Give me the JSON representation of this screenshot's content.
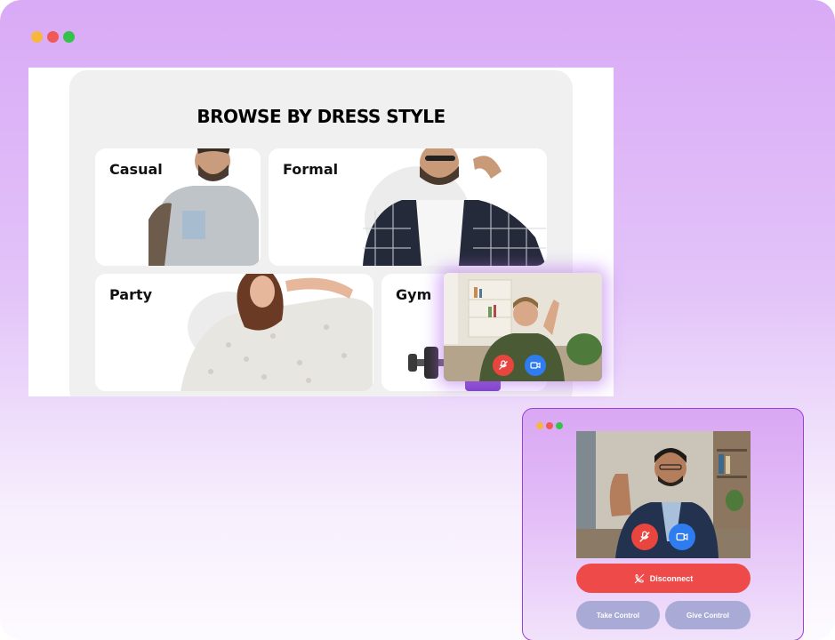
{
  "colors": {
    "traffic_yellow": "#f6b73c",
    "traffic_red": "#ef5a56",
    "traffic_green": "#35c24a",
    "disconnect": "#ef4a4a",
    "control": "#a9aad6",
    "mic_off": "#e8453e",
    "camera": "#2e7cf0"
  },
  "browser": {
    "title": "BROWSE BY DRESS STYLE",
    "cards": [
      {
        "label": "Casual"
      },
      {
        "label": "Formal"
      },
      {
        "label": "Party"
      },
      {
        "label": "Gym"
      }
    ]
  },
  "pip_call": {
    "mic_icon": "mic-off-icon",
    "camera_icon": "video-camera-icon"
  },
  "mini_call": {
    "mic_icon": "mic-off-icon",
    "camera_icon": "video-camera-icon",
    "disconnect_label": "Disconnect",
    "disconnect_icon": "phone-off-icon",
    "take_control_label": "Take Control",
    "give_control_label": "Give Control"
  }
}
